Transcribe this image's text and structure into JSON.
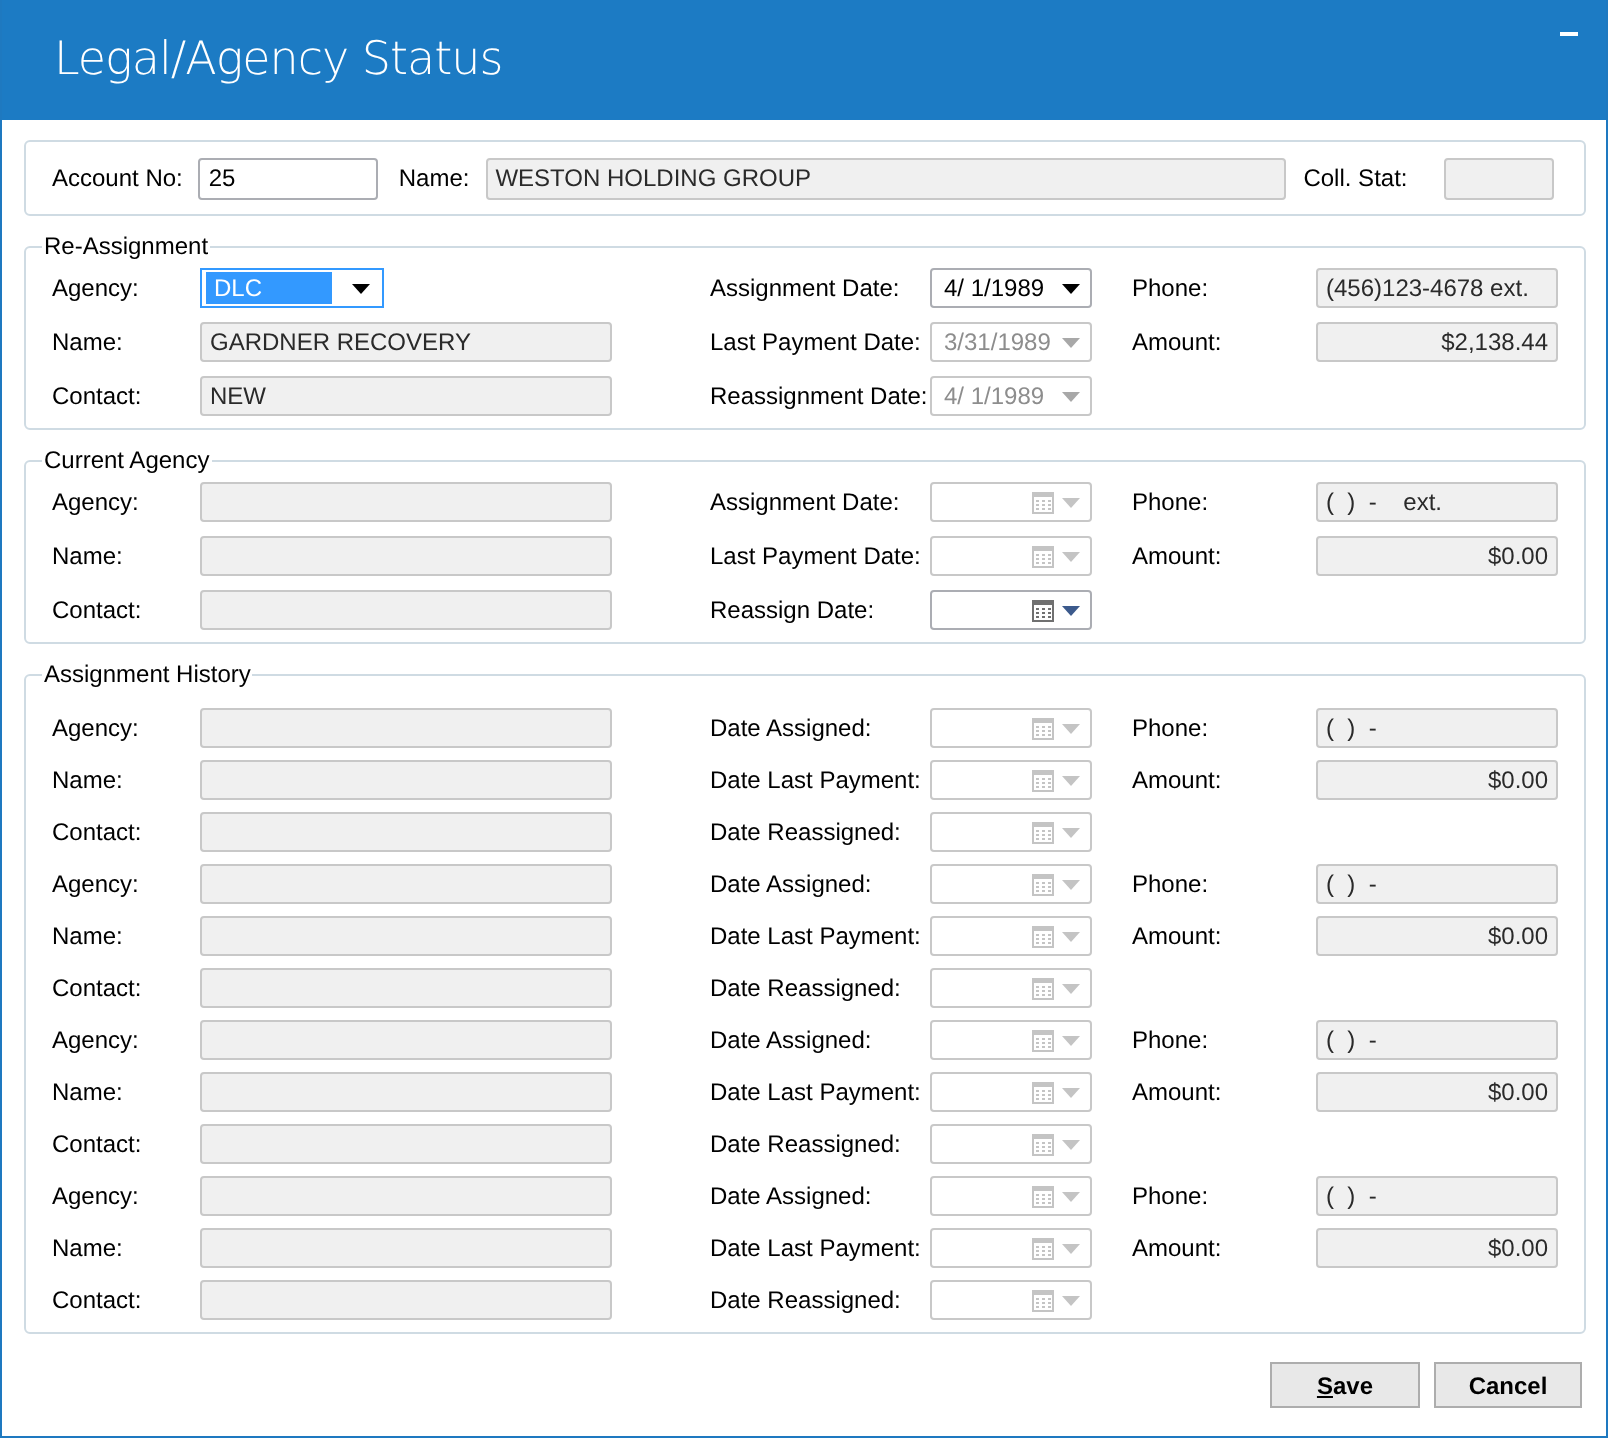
{
  "window": {
    "title": "Legal/Agency Status"
  },
  "header": {
    "account_label": "Account No:",
    "account": {
      "value": "25",
      "enabled": true
    },
    "name_label": "Name:",
    "name": {
      "value": "WESTON HOLDING GROUP",
      "enabled": false
    },
    "coll_label": "Coll. Stat:",
    "coll": {
      "enabled": false
    }
  },
  "sections": [
    {
      "title": "Re-Assignment",
      "rows": [
        {
          "left": {
            "label": "Agency:",
            "field": {
              "kind": "dropdown",
              "value": "DLC",
              "focused": true
            }
          },
          "middle": {
            "label": "Assignment Date:",
            "date": {
              "value": "4/ 1/1989",
              "enabled": true
            }
          },
          "right": {
            "label": "Phone:",
            "field": {
              "kind": "text",
              "value": "(456)123-4678 ext.",
              "enabled": false
            }
          }
        },
        {
          "left": {
            "label": "Name:",
            "field": {
              "kind": "text",
              "value": "GARDNER RECOVERY",
              "enabled": false
            }
          },
          "middle": {
            "label": "Last Payment Date:",
            "date": {
              "value": "3/31/1989",
              "enabled": false
            }
          },
          "right": {
            "label": "Amount:",
            "field": {
              "kind": "amount",
              "value": "$2,138.44",
              "enabled": false
            }
          }
        },
        {
          "left": {
            "label": "Contact:",
            "field": {
              "kind": "text",
              "value": "NEW",
              "enabled": false
            }
          },
          "middle": {
            "label": "Reassignment Date:",
            "date": {
              "value": "4/ 1/1989",
              "enabled": false
            }
          }
        }
      ]
    },
    {
      "title": "Current Agency",
      "rows": [
        {
          "left": {
            "label": "Agency:",
            "field": {
              "kind": "text",
              "enabled": false
            }
          },
          "middle": {
            "label": "Assignment Date:",
            "date": {
              "enabled": false
            }
          },
          "right": {
            "label": "Phone:",
            "field": {
              "kind": "text",
              "value": "(  )  -    ext.",
              "enabled": false
            }
          }
        },
        {
          "left": {
            "label": "Name:",
            "field": {
              "kind": "text",
              "enabled": false
            }
          },
          "middle": {
            "label": "Last Payment Date:",
            "date": {
              "enabled": false
            }
          },
          "right": {
            "label": "Amount:",
            "field": {
              "kind": "amount",
              "value": "$0.00",
              "enabled": false
            }
          }
        },
        {
          "left": {
            "label": "Contact:",
            "field": {
              "kind": "text",
              "enabled": false
            }
          },
          "middle": {
            "label": "Reassign Date:",
            "date": {
              "enabled": true
            }
          }
        }
      ]
    },
    {
      "title": "Assignment History",
      "rows": [
        {
          "left": {
            "label": "Agency:",
            "field": {
              "kind": "text",
              "enabled": false
            }
          },
          "middle": {
            "label": "Date Assigned:",
            "date": {
              "enabled": false
            }
          },
          "right": {
            "label": "Phone:",
            "field": {
              "kind": "text",
              "value": "(  )  -",
              "enabled": false
            }
          }
        },
        {
          "left": {
            "label": "Name:",
            "field": {
              "kind": "text",
              "enabled": false
            }
          },
          "middle": {
            "label": "Date Last Payment:",
            "date": {
              "enabled": false
            }
          },
          "right": {
            "label": "Amount:",
            "field": {
              "kind": "amount",
              "value": "$0.00",
              "enabled": false
            }
          }
        },
        {
          "left": {
            "label": "Contact:",
            "field": {
              "kind": "text",
              "enabled": false
            }
          },
          "middle": {
            "label": "Date Reassigned:",
            "date": {
              "enabled": false
            }
          }
        },
        {
          "left": {
            "label": "Agency:",
            "field": {
              "kind": "text",
              "enabled": false
            }
          },
          "middle": {
            "label": "Date Assigned:",
            "date": {
              "enabled": false
            }
          },
          "right": {
            "label": "Phone:",
            "field": {
              "kind": "text",
              "value": "(  )  -",
              "enabled": false
            }
          }
        },
        {
          "left": {
            "label": "Name:",
            "field": {
              "kind": "text",
              "enabled": false
            }
          },
          "middle": {
            "label": "Date Last Payment:",
            "date": {
              "enabled": false
            }
          },
          "right": {
            "label": "Amount:",
            "field": {
              "kind": "amount",
              "value": "$0.00",
              "enabled": false
            }
          }
        },
        {
          "left": {
            "label": "Contact:",
            "field": {
              "kind": "text",
              "enabled": false
            }
          },
          "middle": {
            "label": "Date Reassigned:",
            "date": {
              "enabled": false
            }
          }
        },
        {
          "left": {
            "label": "Agency:",
            "field": {
              "kind": "text",
              "enabled": false
            }
          },
          "middle": {
            "label": "Date Assigned:",
            "date": {
              "enabled": false
            }
          },
          "right": {
            "label": "Phone:",
            "field": {
              "kind": "text",
              "value": "(  )  -",
              "enabled": false
            }
          }
        },
        {
          "left": {
            "label": "Name:",
            "field": {
              "kind": "text",
              "enabled": false
            }
          },
          "middle": {
            "label": "Date Last Payment:",
            "date": {
              "enabled": false
            }
          },
          "right": {
            "label": "Amount:",
            "field": {
              "kind": "amount",
              "value": "$0.00",
              "enabled": false
            }
          }
        },
        {
          "left": {
            "label": "Contact:",
            "field": {
              "kind": "text",
              "enabled": false
            }
          },
          "middle": {
            "label": "Date Reassigned:",
            "date": {
              "enabled": false
            }
          }
        },
        {
          "left": {
            "label": "Agency:",
            "field": {
              "kind": "text",
              "enabled": false
            }
          },
          "middle": {
            "label": "Date Assigned:",
            "date": {
              "enabled": false
            }
          },
          "right": {
            "label": "Phone:",
            "field": {
              "kind": "text",
              "value": "(  )  -",
              "enabled": false
            }
          }
        },
        {
          "left": {
            "label": "Name:",
            "field": {
              "kind": "text",
              "enabled": false
            }
          },
          "middle": {
            "label": "Date Last Payment:",
            "date": {
              "enabled": false
            }
          },
          "right": {
            "label": "Amount:",
            "field": {
              "kind": "amount",
              "value": "$0.00",
              "enabled": false
            }
          }
        },
        {
          "left": {
            "label": "Contact:",
            "field": {
              "kind": "text",
              "enabled": false
            }
          },
          "middle": {
            "label": "Date Reassigned:",
            "date": {
              "enabled": false
            }
          }
        }
      ]
    }
  ],
  "buttons": [
    {
      "label": "Save",
      "mnemonic": true
    },
    {
      "label": "Cancel"
    }
  ]
}
